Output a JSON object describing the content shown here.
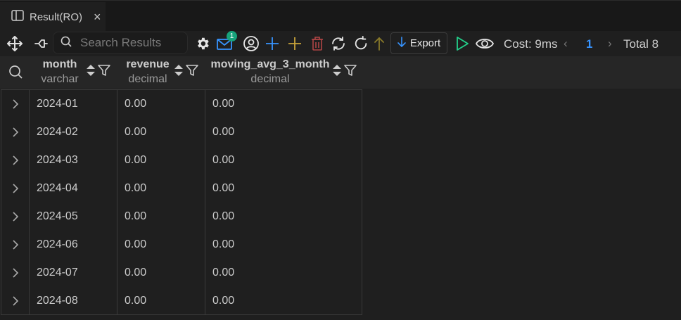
{
  "tab": {
    "title": "Result(RO)",
    "close": "×"
  },
  "toolbar": {
    "search_placeholder": "Search Results",
    "notification_count": "1",
    "export_label": "Export",
    "cost_label": "Cost: 9ms",
    "page_prev": "‹",
    "page_current": "1",
    "page_next": "›",
    "total_label": "Total 8",
    "accent_color": "#3794ff",
    "run_color": "#23d18b"
  },
  "columns": [
    {
      "name": "month",
      "type": "varchar"
    },
    {
      "name": "revenue",
      "type": "decimal"
    },
    {
      "name": "moving_avg_3_month",
      "type": "decimal"
    }
  ],
  "rows": [
    [
      "2024-01",
      "0.00",
      "0.00"
    ],
    [
      "2024-02",
      "0.00",
      "0.00"
    ],
    [
      "2024-03",
      "0.00",
      "0.00"
    ],
    [
      "2024-04",
      "0.00",
      "0.00"
    ],
    [
      "2024-05",
      "0.00",
      "0.00"
    ],
    [
      "2024-06",
      "0.00",
      "0.00"
    ],
    [
      "2024-07",
      "0.00",
      "0.00"
    ],
    [
      "2024-08",
      "0.00",
      "0.00"
    ]
  ]
}
